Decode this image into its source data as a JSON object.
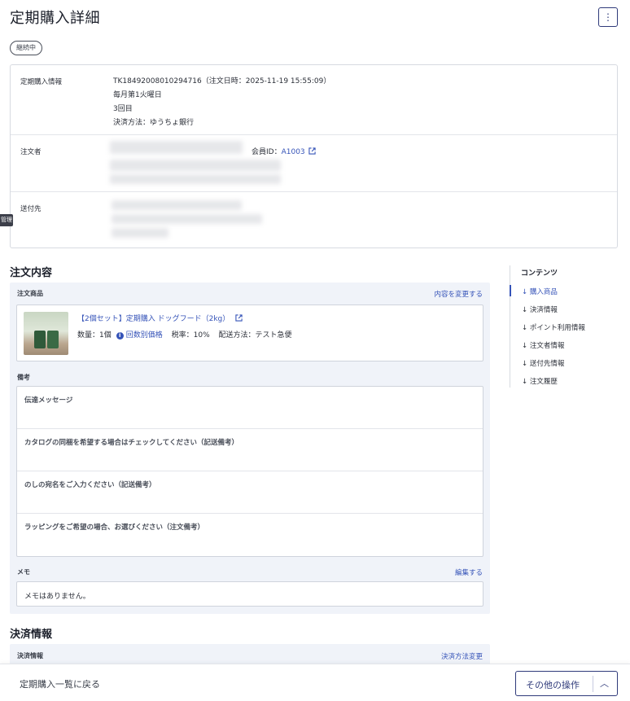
{
  "page": {
    "title": "定期購入詳細",
    "status": "継続中",
    "menu_icon": "kebab-icon"
  },
  "side_tab": {
    "label": "管理"
  },
  "info": {
    "subscription": {
      "label": "定期購入情報",
      "lines": [
        "TK18492008010294716（注文日時：2025-11-19 15:55:09）",
        "毎月第1火曜日",
        "3回目",
        "決済方法：ゆうちょ銀行"
      ]
    },
    "orderer": {
      "label": "注文者",
      "member_prefix": "会員ID：",
      "member_id": "A1003"
    },
    "shipping": {
      "label": "送付先"
    }
  },
  "order": {
    "title": "注文内容",
    "products_label": "注文商品",
    "change_link": "内容を変更する",
    "product": {
      "name": "【2個セット】定期購入 ドッグフード（2kg）",
      "quantity": "数量：1個",
      "price_by_count": "回数別価格",
      "tax": "税率：10%",
      "delivery": "配送方法：テスト急便"
    },
    "remarks_label": "備考",
    "remarks": [
      "伝達メッセージ",
      "カタログの同梱を希望する場合はチェックしてください（記送備考）",
      "のしの宛名をご入力ください（記送備考）",
      "ラッピングをご希望の場合、お選びください（注文備考）"
    ],
    "memo_label": "メモ",
    "memo_edit": "編集する",
    "memo_text": "メモはありません。"
  },
  "payment": {
    "title": "決済情報",
    "label": "決済情報",
    "change_link": "決済方法変更"
  },
  "toc": {
    "title": "コンテンツ",
    "items": [
      "購入商品",
      "決済情報",
      "ポイント利用情報",
      "注文者情報",
      "送付先情報",
      "注文履歴"
    ]
  },
  "footer": {
    "back": "定期購入一覧に戻る",
    "more": "その他の操作"
  },
  "colors": {
    "accent": "#3553b8",
    "primary_dark": "#2f3a7a",
    "panel_bg": "#f0f3f9"
  }
}
